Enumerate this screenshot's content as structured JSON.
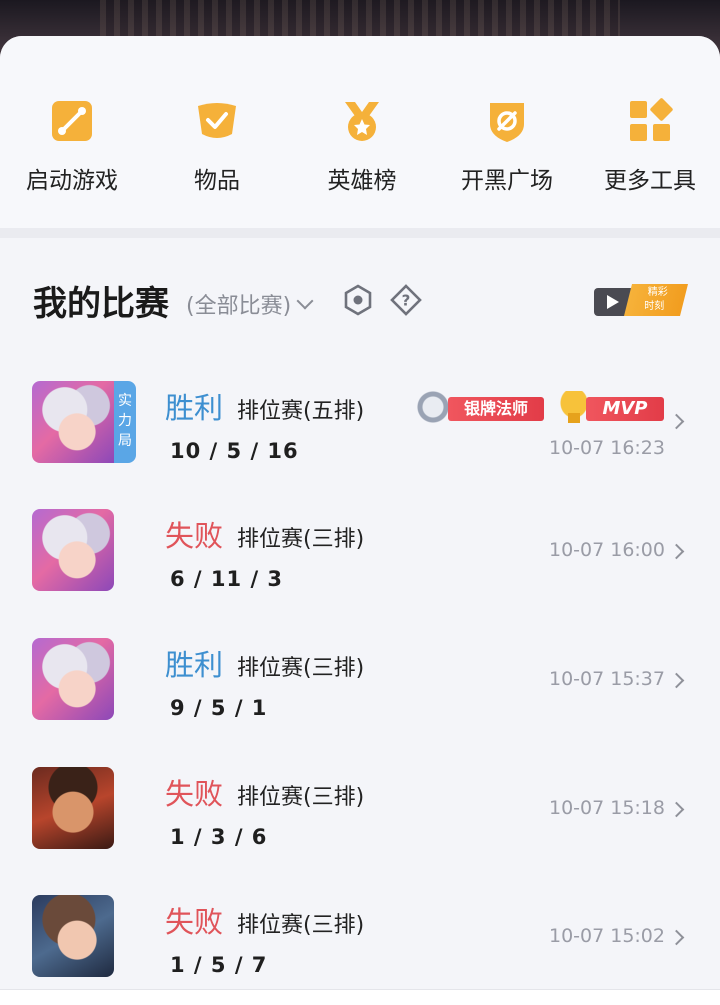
{
  "tools": [
    {
      "label": "启动游戏",
      "icon": "launch-game-icon"
    },
    {
      "label": "物品",
      "icon": "items-icon"
    },
    {
      "label": "英雄榜",
      "icon": "hero-ranking-icon"
    },
    {
      "label": "开黑广场",
      "icon": "team-square-icon"
    },
    {
      "label": "更多工具",
      "icon": "more-tools-icon"
    }
  ],
  "matches_section": {
    "title": "我的比赛",
    "filter": "(全部比赛)",
    "video_badge": [
      "精彩",
      "时刻"
    ]
  },
  "matches": [
    {
      "result": "胜利",
      "outcome": "win",
      "mode": "排位赛(五排)",
      "kda": "10 / 5 / 16",
      "time": "10-07 16:23",
      "tag": "实力局",
      "badges": {
        "title": "银牌法师",
        "mvp": "MVP"
      }
    },
    {
      "result": "失败",
      "outcome": "loss",
      "mode": "排位赛(三排)",
      "kda": "6 / 11 / 3",
      "time": "10-07 16:00"
    },
    {
      "result": "胜利",
      "outcome": "win",
      "mode": "排位赛(三排)",
      "kda": "9 / 5 / 1",
      "time": "10-07 15:37"
    },
    {
      "result": "失败",
      "outcome": "loss",
      "mode": "排位赛(三排)",
      "kda": "1 / 3 / 6",
      "time": "10-07 15:18"
    },
    {
      "result": "失败",
      "outcome": "loss",
      "mode": "排位赛(三排)",
      "kda": "1 / 5 / 7",
      "time": "10-07 15:02"
    }
  ],
  "colors": {
    "accent_orange": "#f5b13a",
    "win_blue": "#3d8fd0",
    "loss_red": "#e0545a",
    "badge_red": "#e23c48"
  }
}
